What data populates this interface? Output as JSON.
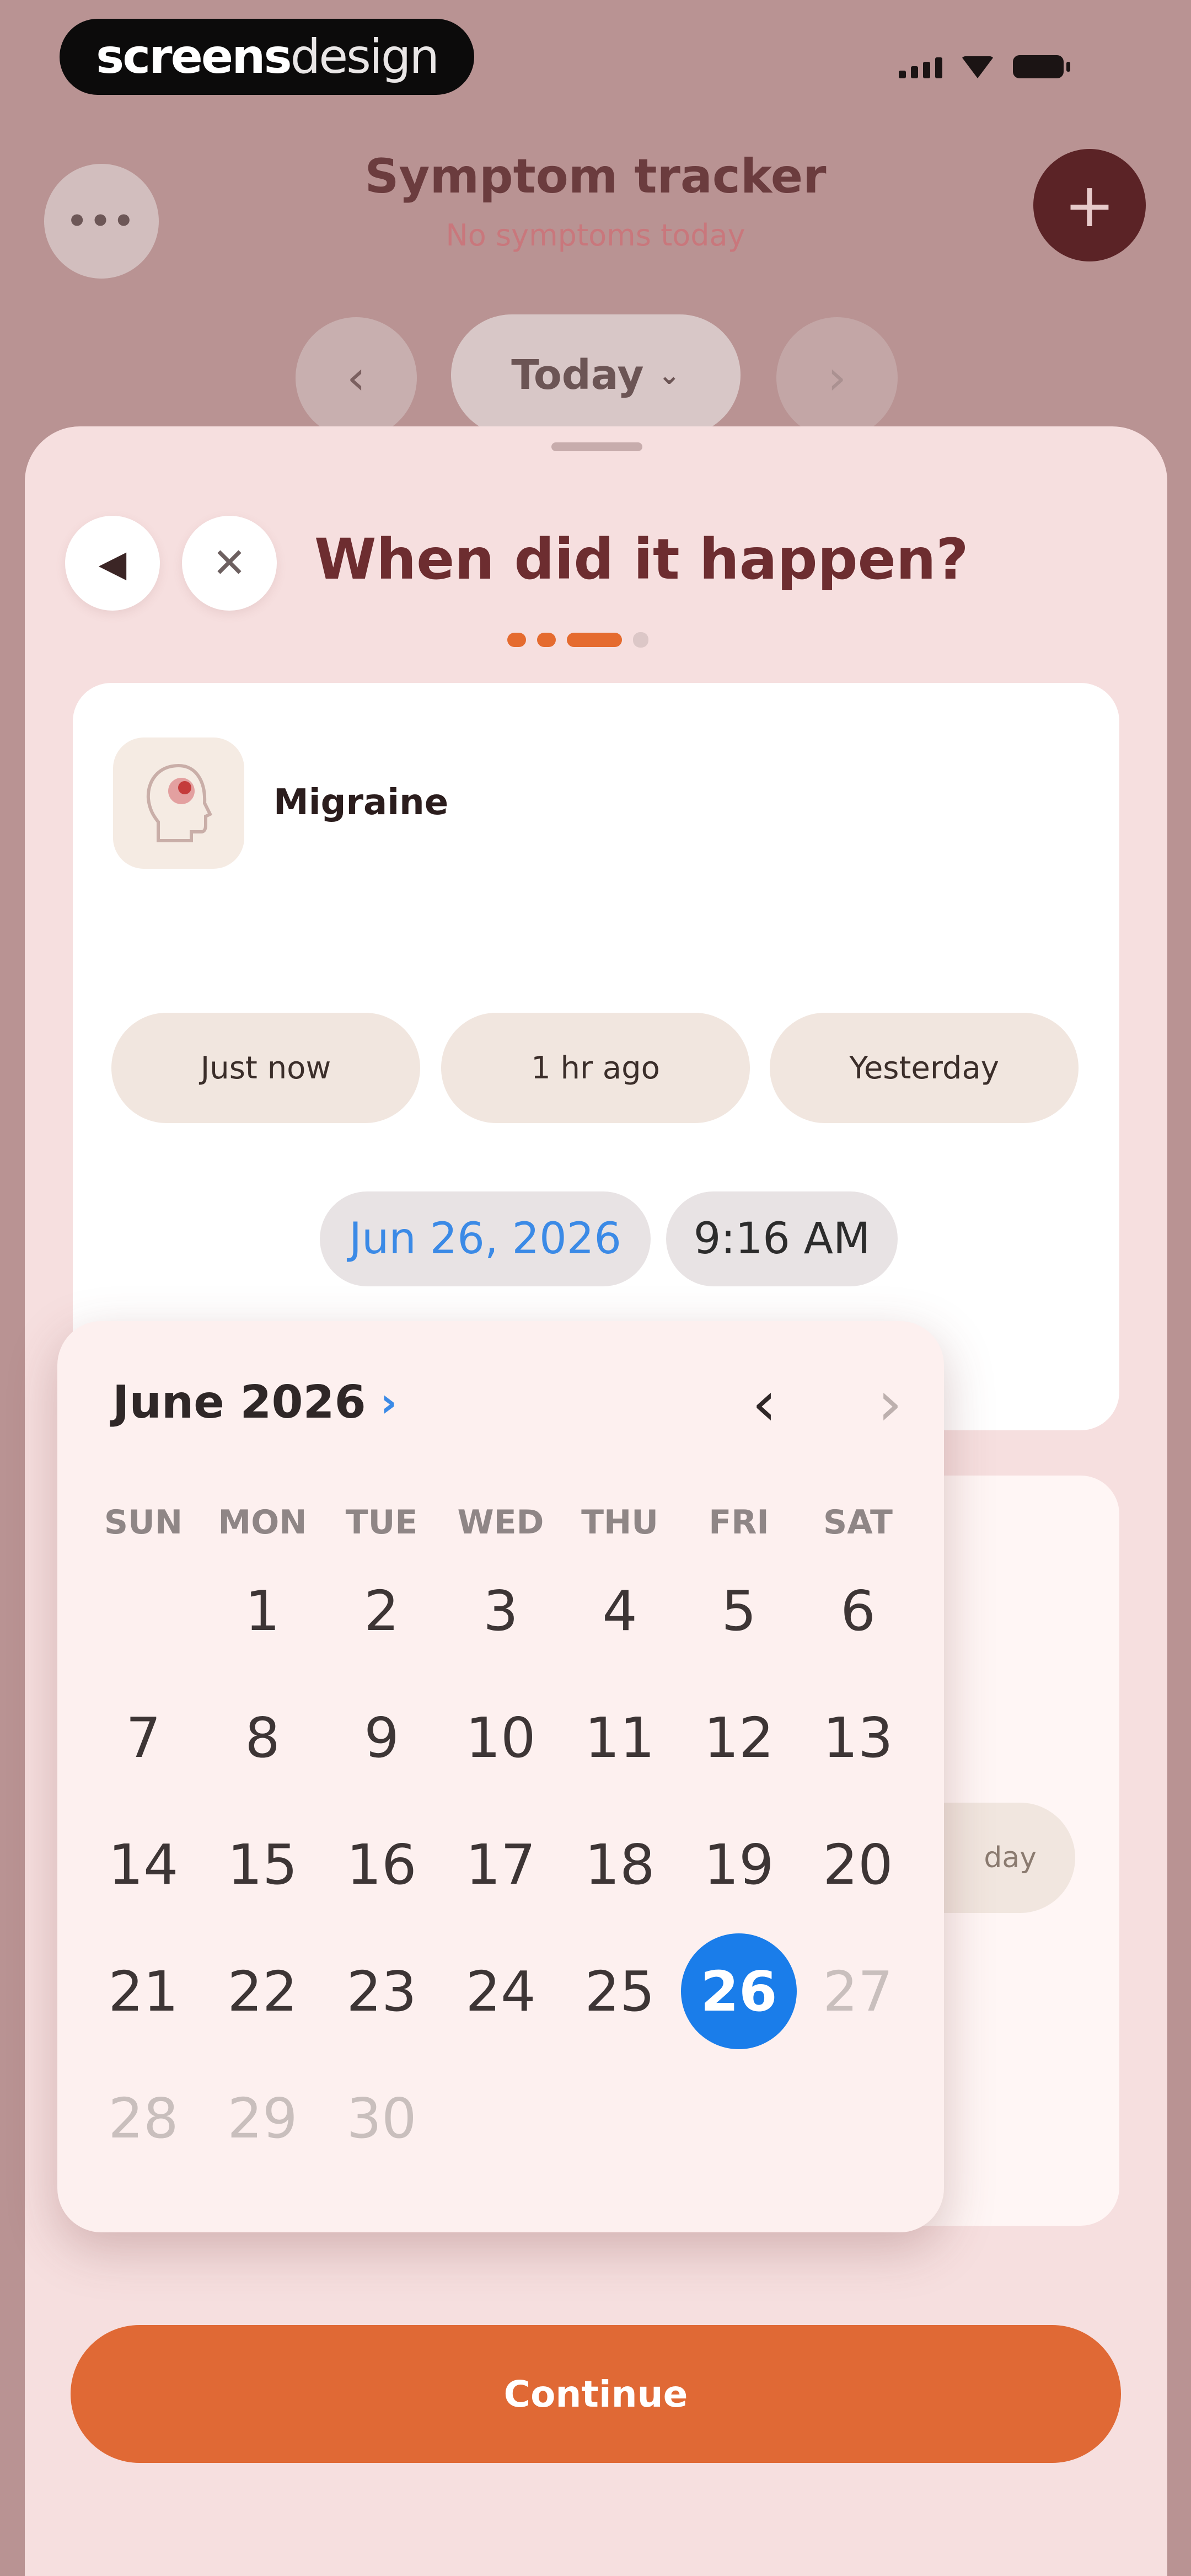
{
  "brand": {
    "bold": "screens",
    "light": "design"
  },
  "header": {
    "title": "Symptom tracker",
    "subtitle": "No symptoms today",
    "more_icon": "more-icon",
    "add_icon": "plus-icon"
  },
  "day_nav": {
    "label": "Today"
  },
  "sheet": {
    "title": "When did it happen?",
    "step_current": 3,
    "step_total": 4
  },
  "symptom": {
    "name": "Migraine",
    "icon": "head-icon"
  },
  "quick_times": [
    "Just now",
    "1 hr ago",
    "Yesterday"
  ],
  "datetime": {
    "date": "Jun 26, 2026",
    "time": "9:16 AM"
  },
  "card2": {
    "pill_text": "day"
  },
  "calendar": {
    "month_label": "June 2026",
    "weekdays": [
      "SUN",
      "MON",
      "TUE",
      "WED",
      "THU",
      "FRI",
      "SAT"
    ],
    "selected_day": 26
  },
  "footer": {
    "continue_label": "Continue"
  },
  "colors": {
    "accent": "#e06935",
    "selected_day": "#1a7dea",
    "title": "#6d2d30"
  }
}
